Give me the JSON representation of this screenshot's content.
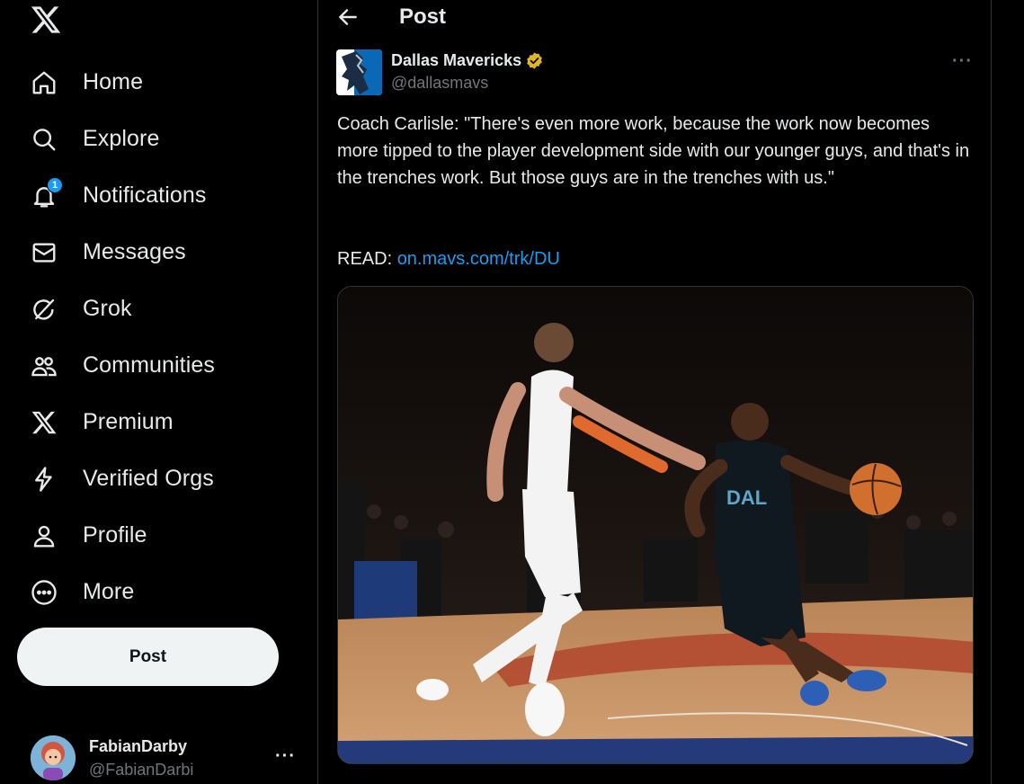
{
  "sidebar": {
    "items": [
      {
        "label": "Home",
        "icon": "home-icon"
      },
      {
        "label": "Explore",
        "icon": "search-icon"
      },
      {
        "label": "Notifications",
        "icon": "bell-icon",
        "badge": "1"
      },
      {
        "label": "Messages",
        "icon": "envelope-icon"
      },
      {
        "label": "Grok",
        "icon": "grok-icon"
      },
      {
        "label": "Communities",
        "icon": "people-icon"
      },
      {
        "label": "Premium",
        "icon": "x-logo-icon"
      },
      {
        "label": "Verified Orgs",
        "icon": "lightning-icon"
      },
      {
        "label": "Profile",
        "icon": "person-icon"
      },
      {
        "label": "More",
        "icon": "more-circle-icon"
      }
    ],
    "post_button": "Post",
    "account": {
      "name": "FabianDarby",
      "handle": "@FabianDarbi",
      "more": "···"
    }
  },
  "header": {
    "title": "Post"
  },
  "post": {
    "author_name": "Dallas Mavericks",
    "author_handle": "@dallasmavs",
    "more": "···",
    "text": "Coach Carlisle: \"There's even more work, because the work now becomes more tipped to the player development side with our younger guys, and that's in the trenches work. But those guys are in the trenches with us.\"",
    "read_prefix": "READ: ",
    "link": "on.mavs.com/trk/DU"
  },
  "colors": {
    "accent": "#1d9bf0",
    "background": "#000000",
    "verified": "#e2b719"
  }
}
